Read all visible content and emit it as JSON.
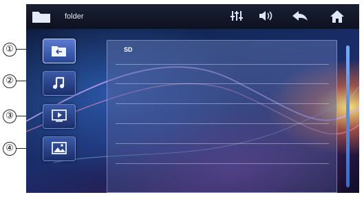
{
  "header": {
    "title": "folder"
  },
  "sidebar": {
    "items": [
      {
        "name": "folder",
        "marker": "①"
      },
      {
        "name": "music",
        "marker": "②"
      },
      {
        "name": "video",
        "marker": "③"
      },
      {
        "name": "photo",
        "marker": "④"
      }
    ]
  },
  "toolbar": {
    "icons": [
      "equalizer-icon",
      "volume-icon",
      "back-icon",
      "home-icon"
    ]
  },
  "list": {
    "label": "SD"
  },
  "colors": {
    "accent": "#3a5aa8",
    "scrollbar": "#4a90ef"
  }
}
